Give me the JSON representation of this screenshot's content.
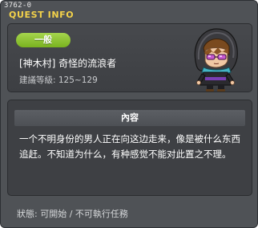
{
  "window": {
    "id": "3762-0",
    "title": "QUEST INFO"
  },
  "quest": {
    "category": "一般",
    "name": "[神木村] 奇怪的流浪者",
    "recommended_level": "建議等級: 125~129"
  },
  "content": {
    "header": "內容",
    "description": "一个不明身份的男人正在向这边走来，像是被什么东西追赶。不知道为什么，有种感觉不能对此置之不理。"
  },
  "status": {
    "text": "狀態:  可開始  / 不可執行任務"
  },
  "colors": {
    "title": "#f3d24a",
    "badge": "#8cc63f",
    "background": "#4f5256"
  },
  "icons": {
    "npc": "hooded-wanderer-portrait"
  }
}
